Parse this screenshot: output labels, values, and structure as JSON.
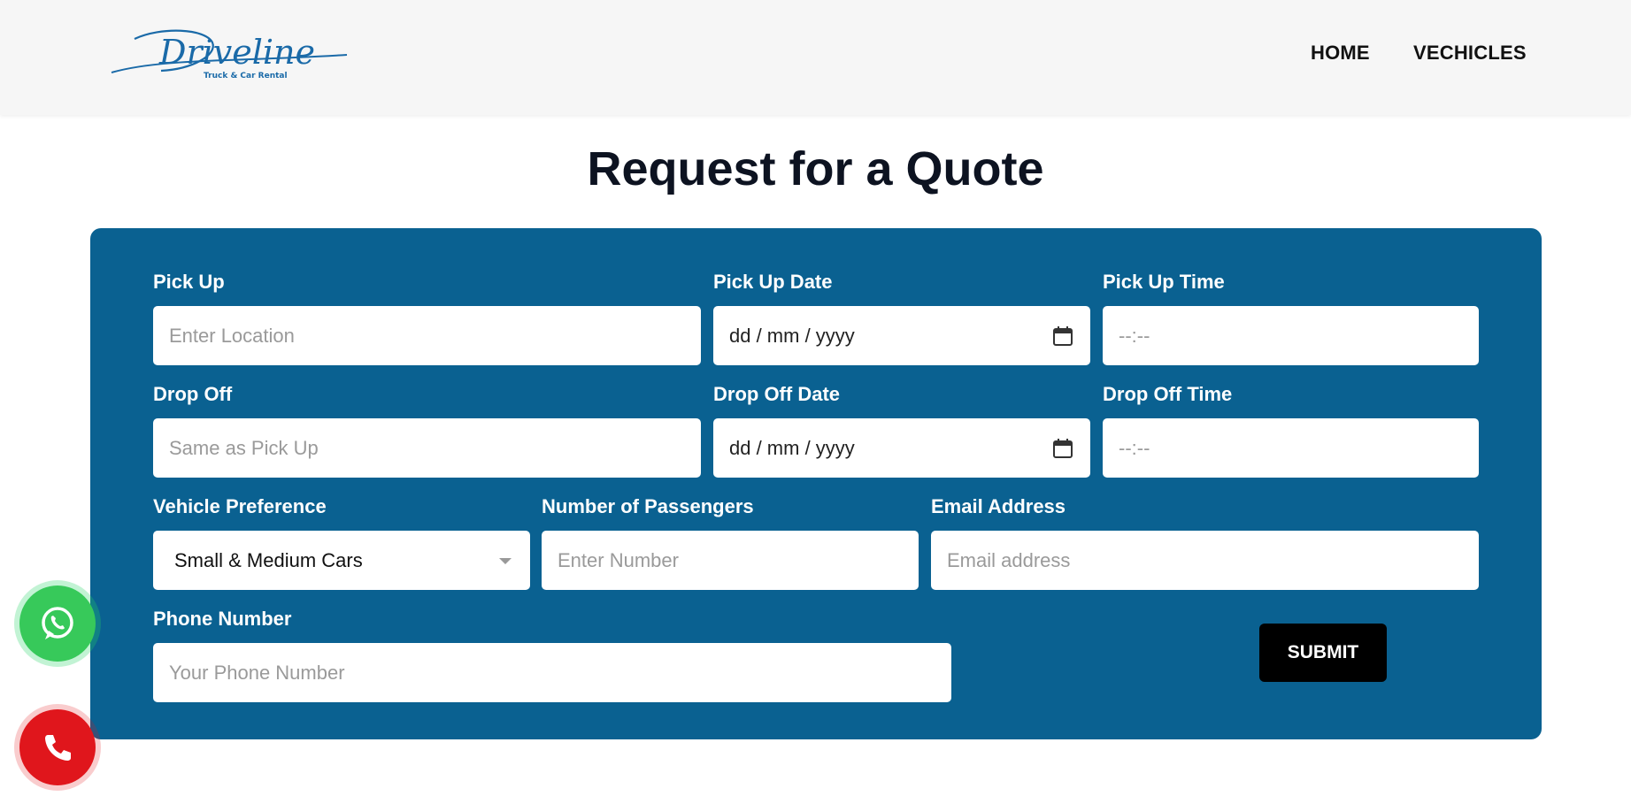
{
  "header": {
    "logo_text": "Driveline",
    "logo_tagline": "Truck & Car Rental",
    "nav": [
      {
        "label": "HOME"
      },
      {
        "label": "VECHICLES"
      }
    ]
  },
  "page_title": "Request for a Quote",
  "form": {
    "pickup": {
      "label": "Pick Up",
      "placeholder": "Enter Location"
    },
    "pickup_date": {
      "label": "Pick Up Date",
      "value": "dd / mm / yyyy"
    },
    "pickup_time": {
      "label": "Pick Up Time",
      "value": "--:--"
    },
    "dropoff": {
      "label": "Drop Off",
      "placeholder": "Same as Pick Up"
    },
    "dropoff_date": {
      "label": "Drop Off Date",
      "value": "dd / mm / yyyy"
    },
    "dropoff_time": {
      "label": "Drop Off Time",
      "value": "--:--"
    },
    "vehicle": {
      "label": "Vehicle Preference",
      "selected": "Small & Medium Cars"
    },
    "passengers": {
      "label": "Number of Passengers",
      "placeholder": "Enter Number"
    },
    "email": {
      "label": "Email Address",
      "placeholder": "Email address"
    },
    "phone": {
      "label": "Phone Number",
      "placeholder": "Your Phone Number"
    },
    "submit_label": "SUBMIT"
  },
  "colors": {
    "panel": "#0a6191",
    "whatsapp": "#37c95a",
    "call": "#e0161c",
    "logo": "#1a6aa8"
  },
  "floating_buttons": [
    {
      "icon": "whatsapp-icon"
    },
    {
      "icon": "phone-icon"
    }
  ]
}
